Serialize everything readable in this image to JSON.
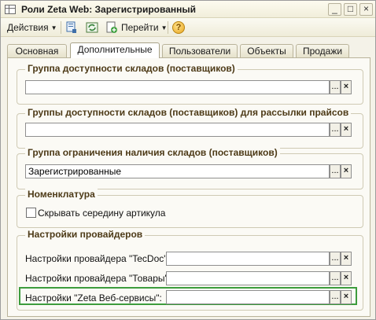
{
  "window": {
    "title": "Роли Zeta Web: Зарегистрированный",
    "minimize_glyph": "_",
    "maximize_glyph": "□",
    "close_glyph": "×"
  },
  "toolbar": {
    "actions_label": "Действия",
    "goto_label": "Перейти",
    "help_glyph": "?"
  },
  "tabs": [
    {
      "label": "Основная"
    },
    {
      "label": "Дополнительные"
    },
    {
      "label": "Пользователи"
    },
    {
      "label": "Объекты"
    },
    {
      "label": "Продажи"
    }
  ],
  "groups": {
    "warehouse_access": {
      "title": "Группа доступности складов (поставщиков)",
      "value": ""
    },
    "warehouse_pricelist": {
      "title": "Группы доступности складов (поставщиков) для рассылки прайсов",
      "value": ""
    },
    "warehouse_restriction": {
      "title": "Группа ограничения наличия складов (поставщиков)",
      "value": "Зарегистрированные"
    },
    "nomenclature": {
      "title": "Номенклатура",
      "hide_middle_label": "Скрывать середину артикула",
      "hide_middle_checked": false
    },
    "providers": {
      "title": "Настройки провайдеров",
      "rows": [
        {
          "label": "Настройки провайдера \"TecDoc\":",
          "value": ""
        },
        {
          "label": "Настройки провайдера \"Товары\":",
          "value": ""
        },
        {
          "label": "Настройки \"Zeta Веб-сервисы\":",
          "value": ""
        }
      ]
    }
  },
  "buttons": {
    "select_glyph": "...",
    "clear_glyph": "×"
  },
  "colors": {
    "group_title": "#4d3a17",
    "highlight": "#3d9c3d",
    "window_bg": "#f4f2e8"
  }
}
